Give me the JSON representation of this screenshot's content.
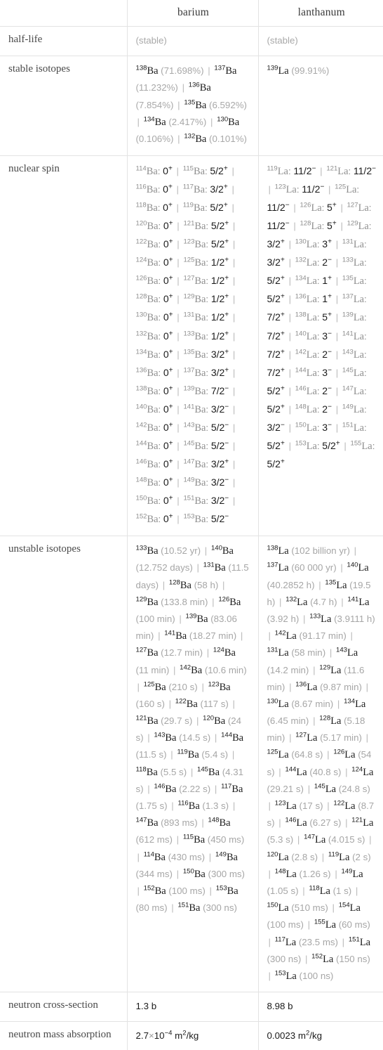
{
  "table": {
    "corner_label": "",
    "columns": [
      "barium",
      "lanthanum"
    ],
    "rows": [
      {
        "label": "half-life",
        "ba": "(stable)",
        "la": "(stable)"
      },
      {
        "label": "stable isotopes"
      },
      {
        "label": "nuclear spin"
      },
      {
        "label": "unstable isotopes"
      },
      {
        "label": "neutron cross-section",
        "ba": "1.3 b",
        "la": "8.98 b"
      },
      {
        "label": "neutron mass absorption",
        "ba": "2.7×10−4 m2/kg",
        "la": "0.0023 m2/kg"
      }
    ]
  },
  "half_life": {
    "ba": "(stable)",
    "la": "(stable)"
  },
  "neutron_cross_section": {
    "ba_value": "1.3",
    "ba_unit": "b",
    "la_value": "8.98",
    "la_unit": "b"
  },
  "neutron_mass_absorption": {
    "ba_mantissa": "2.7",
    "ba_times": "×",
    "ba_base": "10",
    "ba_exp": "−4",
    "ba_unit_m": "m",
    "ba_unit_sup": "2",
    "ba_unit_rest": "/kg",
    "la_value": "0.0023",
    "la_unit_m": "m",
    "la_unit_sup": "2",
    "la_unit_rest": "/kg"
  },
  "stable_isotopes": {
    "ba": [
      {
        "a": "138",
        "sym": "Ba",
        "pct": "(71.698%)"
      },
      {
        "a": "137",
        "sym": "Ba",
        "pct": "(11.232%)"
      },
      {
        "a": "136",
        "sym": "Ba",
        "pct": "(7.854%)"
      },
      {
        "a": "135",
        "sym": "Ba",
        "pct": "(6.592%)"
      },
      {
        "a": "134",
        "sym": "Ba",
        "pct": "(2.417%)"
      },
      {
        "a": "130",
        "sym": "Ba",
        "pct": "(0.106%)"
      },
      {
        "a": "132",
        "sym": "Ba",
        "pct": "(0.101%)"
      }
    ],
    "la": [
      {
        "a": "139",
        "sym": "La",
        "pct": "(99.91%)"
      }
    ]
  },
  "nuclear_spin": {
    "ba": [
      {
        "a": "114",
        "sym": "Ba",
        "spin": "0",
        "sign": "+"
      },
      {
        "a": "115",
        "sym": "Ba",
        "spin": "5/2",
        "sign": "+"
      },
      {
        "a": "116",
        "sym": "Ba",
        "spin": "0",
        "sign": "+"
      },
      {
        "a": "117",
        "sym": "Ba",
        "spin": "3/2",
        "sign": "+"
      },
      {
        "a": "118",
        "sym": "Ba",
        "spin": "0",
        "sign": "+"
      },
      {
        "a": "119",
        "sym": "Ba",
        "spin": "5/2",
        "sign": "+"
      },
      {
        "a": "120",
        "sym": "Ba",
        "spin": "0",
        "sign": "+"
      },
      {
        "a": "121",
        "sym": "Ba",
        "spin": "5/2",
        "sign": "+"
      },
      {
        "a": "122",
        "sym": "Ba",
        "spin": "0",
        "sign": "+"
      },
      {
        "a": "123",
        "sym": "Ba",
        "spin": "5/2",
        "sign": "+"
      },
      {
        "a": "124",
        "sym": "Ba",
        "spin": "0",
        "sign": "+"
      },
      {
        "a": "125",
        "sym": "Ba",
        "spin": "1/2",
        "sign": "+"
      },
      {
        "a": "126",
        "sym": "Ba",
        "spin": "0",
        "sign": "+"
      },
      {
        "a": "127",
        "sym": "Ba",
        "spin": "1/2",
        "sign": "+"
      },
      {
        "a": "128",
        "sym": "Ba",
        "spin": "0",
        "sign": "+"
      },
      {
        "a": "129",
        "sym": "Ba",
        "spin": "1/2",
        "sign": "+"
      },
      {
        "a": "130",
        "sym": "Ba",
        "spin": "0",
        "sign": "+"
      },
      {
        "a": "131",
        "sym": "Ba",
        "spin": "1/2",
        "sign": "+"
      },
      {
        "a": "132",
        "sym": "Ba",
        "spin": "0",
        "sign": "+"
      },
      {
        "a": "133",
        "sym": "Ba",
        "spin": "1/2",
        "sign": "+"
      },
      {
        "a": "134",
        "sym": "Ba",
        "spin": "0",
        "sign": "+"
      },
      {
        "a": "135",
        "sym": "Ba",
        "spin": "3/2",
        "sign": "+"
      },
      {
        "a": "136",
        "sym": "Ba",
        "spin": "0",
        "sign": "+"
      },
      {
        "a": "137",
        "sym": "Ba",
        "spin": "3/2",
        "sign": "+"
      },
      {
        "a": "138",
        "sym": "Ba",
        "spin": "0",
        "sign": "+"
      },
      {
        "a": "139",
        "sym": "Ba",
        "spin": "7/2",
        "sign": "−"
      },
      {
        "a": "140",
        "sym": "Ba",
        "spin": "0",
        "sign": "+"
      },
      {
        "a": "141",
        "sym": "Ba",
        "spin": "3/2",
        "sign": "−"
      },
      {
        "a": "142",
        "sym": "Ba",
        "spin": "0",
        "sign": "+"
      },
      {
        "a": "143",
        "sym": "Ba",
        "spin": "5/2",
        "sign": "−"
      },
      {
        "a": "144",
        "sym": "Ba",
        "spin": "0",
        "sign": "+"
      },
      {
        "a": "145",
        "sym": "Ba",
        "spin": "5/2",
        "sign": "−"
      },
      {
        "a": "146",
        "sym": "Ba",
        "spin": "0",
        "sign": "+"
      },
      {
        "a": "147",
        "sym": "Ba",
        "spin": "3/2",
        "sign": "+"
      },
      {
        "a": "148",
        "sym": "Ba",
        "spin": "0",
        "sign": "+"
      },
      {
        "a": "149",
        "sym": "Ba",
        "spin": "3/2",
        "sign": "−"
      },
      {
        "a": "150",
        "sym": "Ba",
        "spin": "0",
        "sign": "+"
      },
      {
        "a": "151",
        "sym": "Ba",
        "spin": "3/2",
        "sign": "−"
      },
      {
        "a": "152",
        "sym": "Ba",
        "spin": "0",
        "sign": "+"
      },
      {
        "a": "153",
        "sym": "Ba",
        "spin": "5/2",
        "sign": "−"
      }
    ],
    "la": [
      {
        "a": "119",
        "sym": "La",
        "spin": "11/2",
        "sign": "−"
      },
      {
        "a": "121",
        "sym": "La",
        "spin": "11/2",
        "sign": "−"
      },
      {
        "a": "123",
        "sym": "La",
        "spin": "11/2",
        "sign": "−"
      },
      {
        "a": "125",
        "sym": "La",
        "spin": "11/2",
        "sign": "−"
      },
      {
        "a": "126",
        "sym": "La",
        "spin": "5",
        "sign": "+"
      },
      {
        "a": "127",
        "sym": "La",
        "spin": "11/2",
        "sign": "−"
      },
      {
        "a": "128",
        "sym": "La",
        "spin": "5",
        "sign": "+"
      },
      {
        "a": "129",
        "sym": "La",
        "spin": "3/2",
        "sign": "+"
      },
      {
        "a": "130",
        "sym": "La",
        "spin": "3",
        "sign": "+"
      },
      {
        "a": "131",
        "sym": "La",
        "spin": "3/2",
        "sign": "+"
      },
      {
        "a": "132",
        "sym": "La",
        "spin": "2",
        "sign": "−"
      },
      {
        "a": "133",
        "sym": "La",
        "spin": "5/2",
        "sign": "+"
      },
      {
        "a": "134",
        "sym": "La",
        "spin": "1",
        "sign": "+"
      },
      {
        "a": "135",
        "sym": "La",
        "spin": "5/2",
        "sign": "+"
      },
      {
        "a": "136",
        "sym": "La",
        "spin": "1",
        "sign": "+"
      },
      {
        "a": "137",
        "sym": "La",
        "spin": "7/2",
        "sign": "+"
      },
      {
        "a": "138",
        "sym": "La",
        "spin": "5",
        "sign": "+"
      },
      {
        "a": "139",
        "sym": "La",
        "spin": "7/2",
        "sign": "+"
      },
      {
        "a": "140",
        "sym": "La",
        "spin": "3",
        "sign": "−"
      },
      {
        "a": "141",
        "sym": "La",
        "spin": "7/2",
        "sign": "+"
      },
      {
        "a": "142",
        "sym": "La",
        "spin": "2",
        "sign": "−"
      },
      {
        "a": "143",
        "sym": "La",
        "spin": "7/2",
        "sign": "+"
      },
      {
        "a": "144",
        "sym": "La",
        "spin": "3",
        "sign": "−"
      },
      {
        "a": "145",
        "sym": "La",
        "spin": "5/2",
        "sign": "+"
      },
      {
        "a": "146",
        "sym": "La",
        "spin": "2",
        "sign": "−"
      },
      {
        "a": "147",
        "sym": "La",
        "spin": "5/2",
        "sign": "+"
      },
      {
        "a": "148",
        "sym": "La",
        "spin": "2",
        "sign": "−"
      },
      {
        "a": "149",
        "sym": "La",
        "spin": "3/2",
        "sign": "−"
      },
      {
        "a": "150",
        "sym": "La",
        "spin": "3",
        "sign": "−"
      },
      {
        "a": "151",
        "sym": "La",
        "spin": "5/2",
        "sign": "+"
      },
      {
        "a": "153",
        "sym": "La",
        "spin": "5/2",
        "sign": "+"
      },
      {
        "a": "155",
        "sym": "La",
        "spin": "5/2",
        "sign": "+"
      }
    ]
  },
  "unstable_isotopes": {
    "ba": [
      {
        "a": "133",
        "sym": "Ba",
        "hl": "(10.52 yr)"
      },
      {
        "a": "140",
        "sym": "Ba",
        "hl": "(12.752 days)"
      },
      {
        "a": "131",
        "sym": "Ba",
        "hl": "(11.5 days)"
      },
      {
        "a": "128",
        "sym": "Ba",
        "hl": "(58 h)"
      },
      {
        "a": "129",
        "sym": "Ba",
        "hl": "(133.8 min)"
      },
      {
        "a": "126",
        "sym": "Ba",
        "hl": "(100 min)"
      },
      {
        "a": "139",
        "sym": "Ba",
        "hl": "(83.06 min)"
      },
      {
        "a": "141",
        "sym": "Ba",
        "hl": "(18.27 min)"
      },
      {
        "a": "127",
        "sym": "Ba",
        "hl": "(12.7 min)"
      },
      {
        "a": "124",
        "sym": "Ba",
        "hl": "(11 min)"
      },
      {
        "a": "142",
        "sym": "Ba",
        "hl": "(10.6 min)"
      },
      {
        "a": "125",
        "sym": "Ba",
        "hl": "(210 s)"
      },
      {
        "a": "123",
        "sym": "Ba",
        "hl": "(160 s)"
      },
      {
        "a": "122",
        "sym": "Ba",
        "hl": "(117 s)"
      },
      {
        "a": "121",
        "sym": "Ba",
        "hl": "(29.7 s)"
      },
      {
        "a": "120",
        "sym": "Ba",
        "hl": "(24 s)"
      },
      {
        "a": "143",
        "sym": "Ba",
        "hl": "(14.5 s)"
      },
      {
        "a": "144",
        "sym": "Ba",
        "hl": "(11.5 s)"
      },
      {
        "a": "119",
        "sym": "Ba",
        "hl": "(5.4 s)"
      },
      {
        "a": "118",
        "sym": "Ba",
        "hl": "(5.5 s)"
      },
      {
        "a": "145",
        "sym": "Ba",
        "hl": "(4.31 s)"
      },
      {
        "a": "146",
        "sym": "Ba",
        "hl": "(2.22 s)"
      },
      {
        "a": "117",
        "sym": "Ba",
        "hl": "(1.75 s)"
      },
      {
        "a": "116",
        "sym": "Ba",
        "hl": "(1.3 s)"
      },
      {
        "a": "147",
        "sym": "Ba",
        "hl": "(893 ms)"
      },
      {
        "a": "148",
        "sym": "Ba",
        "hl": "(612 ms)"
      },
      {
        "a": "115",
        "sym": "Ba",
        "hl": "(450 ms)"
      },
      {
        "a": "114",
        "sym": "Ba",
        "hl": "(430 ms)"
      },
      {
        "a": "149",
        "sym": "Ba",
        "hl": "(344 ms)"
      },
      {
        "a": "150",
        "sym": "Ba",
        "hl": "(300 ms)"
      },
      {
        "a": "152",
        "sym": "Ba",
        "hl": "(100 ms)"
      },
      {
        "a": "153",
        "sym": "Ba",
        "hl": "(80 ms)"
      },
      {
        "a": "151",
        "sym": "Ba",
        "hl": "(300 ns)"
      }
    ],
    "la": [
      {
        "a": "138",
        "sym": "La",
        "hl": "(102 billion yr)"
      },
      {
        "a": "137",
        "sym": "La",
        "hl": "(60 000 yr)"
      },
      {
        "a": "140",
        "sym": "La",
        "hl": "(40.2852 h)"
      },
      {
        "a": "135",
        "sym": "La",
        "hl": "(19.5 h)"
      },
      {
        "a": "132",
        "sym": "La",
        "hl": "(4.7 h)"
      },
      {
        "a": "141",
        "sym": "La",
        "hl": "(3.92 h)"
      },
      {
        "a": "133",
        "sym": "La",
        "hl": "(3.9111 h)"
      },
      {
        "a": "142",
        "sym": "La",
        "hl": "(91.17 min)"
      },
      {
        "a": "131",
        "sym": "La",
        "hl": "(58 min)"
      },
      {
        "a": "143",
        "sym": "La",
        "hl": "(14.2 min)"
      },
      {
        "a": "129",
        "sym": "La",
        "hl": "(11.6 min)"
      },
      {
        "a": "136",
        "sym": "La",
        "hl": "(9.87 min)"
      },
      {
        "a": "130",
        "sym": "La",
        "hl": "(8.67 min)"
      },
      {
        "a": "134",
        "sym": "La",
        "hl": "(6.45 min)"
      },
      {
        "a": "128",
        "sym": "La",
        "hl": "(5.18 min)"
      },
      {
        "a": "127",
        "sym": "La",
        "hl": "(5.17 min)"
      },
      {
        "a": "125",
        "sym": "La",
        "hl": "(64.8 s)"
      },
      {
        "a": "126",
        "sym": "La",
        "hl": "(54 s)"
      },
      {
        "a": "144",
        "sym": "La",
        "hl": "(40.8 s)"
      },
      {
        "a": "124",
        "sym": "La",
        "hl": "(29.21 s)"
      },
      {
        "a": "145",
        "sym": "La",
        "hl": "(24.8 s)"
      },
      {
        "a": "123",
        "sym": "La",
        "hl": "(17 s)"
      },
      {
        "a": "122",
        "sym": "La",
        "hl": "(8.7 s)"
      },
      {
        "a": "146",
        "sym": "La",
        "hl": "(6.27 s)"
      },
      {
        "a": "121",
        "sym": "La",
        "hl": "(5.3 s)"
      },
      {
        "a": "147",
        "sym": "La",
        "hl": "(4.015 s)"
      },
      {
        "a": "120",
        "sym": "La",
        "hl": "(2.8 s)"
      },
      {
        "a": "119",
        "sym": "La",
        "hl": "(2 s)"
      },
      {
        "a": "148",
        "sym": "La",
        "hl": "(1.26 s)"
      },
      {
        "a": "149",
        "sym": "La",
        "hl": "(1.05 s)"
      },
      {
        "a": "118",
        "sym": "La",
        "hl": "(1 s)"
      },
      {
        "a": "150",
        "sym": "La",
        "hl": "(510 ms)"
      },
      {
        "a": "154",
        "sym": "La",
        "hl": "(100 ms)"
      },
      {
        "a": "155",
        "sym": "La",
        "hl": "(60 ms)"
      },
      {
        "a": "117",
        "sym": "La",
        "hl": "(23.5 ms)"
      },
      {
        "a": "151",
        "sym": "La",
        "hl": "(300 ns)"
      },
      {
        "a": "152",
        "sym": "La",
        "hl": "(150 ns)"
      },
      {
        "a": "153",
        "sym": "La",
        "hl": "(100 ns)"
      }
    ]
  },
  "separator": "|"
}
